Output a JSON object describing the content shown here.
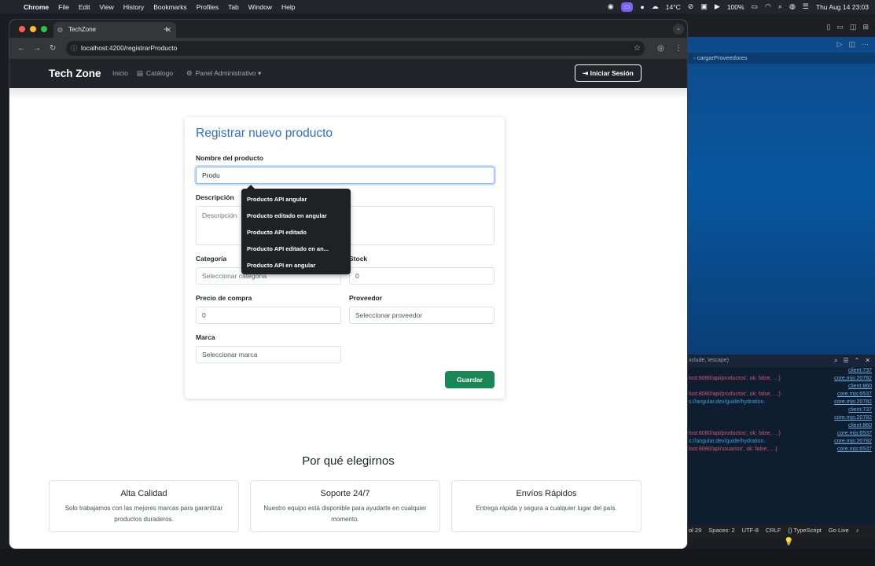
{
  "menubar": {
    "app": "Chrome",
    "items": [
      "File",
      "Edit",
      "View",
      "History",
      "Bookmarks",
      "Profiles",
      "Tab",
      "Window",
      "Help"
    ],
    "weather": "14°C",
    "battery": "100%",
    "datetime": "Thu Aug 14  23:03"
  },
  "browser": {
    "tab_title": "TechZone",
    "url": "localhost:4200/registrarProducto"
  },
  "site": {
    "brand": "Tech Zone",
    "nav": {
      "home": "Inicio",
      "catalog": "Catálogo",
      "admin": "Panel Administrativo"
    },
    "login": "Iniciar Sesión"
  },
  "form": {
    "title": "Registrar nuevo producto",
    "name_label": "Nombre del producto",
    "name_value": "Produ",
    "description_label": "Descripción",
    "description_placeholder": "Descripción",
    "category_label": "Categoría",
    "category_value": "Seleccionar categoría",
    "stock_label": "Stock",
    "stock_value": "0",
    "price_label": "Precio de compra",
    "price_value": "0",
    "supplier_label": "Proveedor",
    "supplier_value": "Seleccionar proveedor",
    "brand_label": "Marca",
    "brand_value": "Seleccionar marca",
    "save": "Guardar"
  },
  "autocomplete": [
    "Producto API angular",
    "Producto editado en angular",
    "Producto API editado",
    "Producto API  editado en an...",
    "Producto API en angular"
  ],
  "why": {
    "title": "Por qué elegirnos",
    "features": [
      {
        "title": "Alta Calidad",
        "desc": "Solo trabajamos con las mejores marcas para garantizar productos duraderos."
      },
      {
        "title": "Soporte 24/7",
        "desc": "Nuestro equipo está disponible para ayudarte en cualquier momento."
      },
      {
        "title": "Envíos Rápidos",
        "desc": "Entrega rápida y segura a cualquier lugar del país."
      }
    ]
  },
  "vscode": {
    "breadcrumb": "cargarProveedores",
    "filter_placeholder": "xclude, \\escape)",
    "console": [
      {
        "text": "",
        "source": "client:737",
        "link": false
      },
      {
        "text": "lost:8080/api/productos', ok: false, …}",
        "source": "core.mjs:20782",
        "link": false
      },
      {
        "text": "",
        "source": "client:860",
        "link": false
      },
      {
        "text": "lost:8080/api/productos', ok: false, …}",
        "source": "core.mjs:6537",
        "link": false
      },
      {
        "text": "s://angular.dev/guide/hydration.",
        "source": "core.mjs:20782",
        "link": true
      },
      {
        "text": "",
        "source": "client:737",
        "link": false
      },
      {
        "text": "",
        "source": "core.mjs:20782",
        "link": false
      },
      {
        "text": "",
        "source": "client:860",
        "link": false
      },
      {
        "text": "lost:8080/api/productos', ok: false, …}",
        "source": "core.mjs:6537",
        "link": false
      },
      {
        "text": "s://angular.dev/guide/hydration.",
        "source": "core.mjs:20782",
        "link": true
      },
      {
        "text": "lost:8080/api/usuarios', ok: false, …}",
        "source": "core.mjs:6537",
        "link": false
      }
    ],
    "status": [
      "ol 29",
      "Spaces: 2",
      "UTF-8",
      "CRLF",
      "{} TypeScript",
      "Go Live"
    ]
  }
}
